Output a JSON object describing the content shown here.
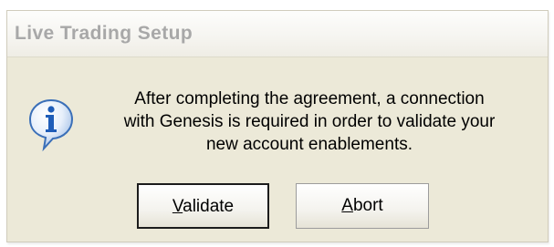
{
  "window": {
    "title": "Live Trading Setup"
  },
  "message": {
    "icon": "info-icon",
    "lines": [
      "After completing the agreement, a connection",
      "with Genesis is required in order to validate your",
      "new account enablements."
    ]
  },
  "buttons": {
    "validate": {
      "mnemonic": "V",
      "rest": "alidate",
      "label": "Validate"
    },
    "abort": {
      "mnemonic": "A",
      "rest": "bort",
      "label": "Abort"
    }
  },
  "colors": {
    "dialog_face": "#ECE9D8",
    "title_text": "#A8A8A8",
    "icon_blue": "#2F6DC5"
  }
}
